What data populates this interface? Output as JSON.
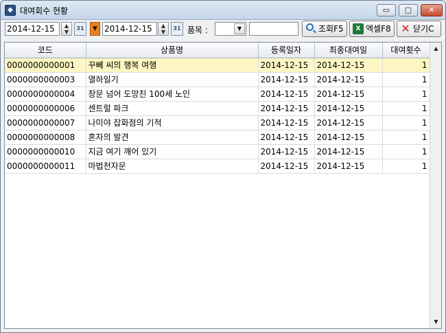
{
  "window": {
    "title": "대여회수 현황",
    "app_icon": "app-icon",
    "buttons": {
      "minimize": "▭",
      "maximize": "□",
      "close": "✕"
    }
  },
  "toolbar": {
    "date_from": "2014-12-15",
    "date_to": "2014-12-15",
    "calendar_label": "31",
    "spin_up": "▲",
    "spin_down": "▼",
    "range_arrow": "▼",
    "category_label": "품목 :",
    "category_value": "",
    "combo_arrow": "▼",
    "search_text": "",
    "search_button": "조회F5",
    "excel_button": "엑셀F8",
    "close_button": "닫기C",
    "excel_icon_text": "X",
    "close_icon_text": "✕"
  },
  "grid": {
    "headers": [
      "코드",
      "상품명",
      "등록일자",
      "최종대여일",
      "대여횟수"
    ],
    "rows": [
      [
        "0000000000001",
        "꾸뻬 씨의 행복 여행",
        "2014-12-15",
        "2014-12-15",
        "1"
      ],
      [
        "0000000000003",
        "열하일기",
        "2014-12-15",
        "2014-12-15",
        "1"
      ],
      [
        "0000000000004",
        "창문 넘어 도망친 100세 노인",
        "2014-12-15",
        "2014-12-15",
        "1"
      ],
      [
        "0000000000006",
        "센트럴 파크",
        "2014-12-15",
        "2014-12-15",
        "1"
      ],
      [
        "0000000000007",
        "나미야 잡화점의 기적",
        "2014-12-15",
        "2014-12-15",
        "1"
      ],
      [
        "0000000000008",
        "혼자의 발견",
        "2014-12-15",
        "2014-12-15",
        "1"
      ],
      [
        "0000000000010",
        "지금 여기 깨어 있기",
        "2014-12-15",
        "2014-12-15",
        "1"
      ],
      [
        "0000000000011",
        "마법천자문",
        "2014-12-15",
        "2014-12-15",
        "1"
      ]
    ],
    "selected_row": 0,
    "scroll_up": "▲",
    "scroll_down": "▼"
  },
  "colors": {
    "selected_row": "#fdf6c3",
    "range_arrow": "#e88220",
    "title_bar": "#c5d6ea"
  }
}
